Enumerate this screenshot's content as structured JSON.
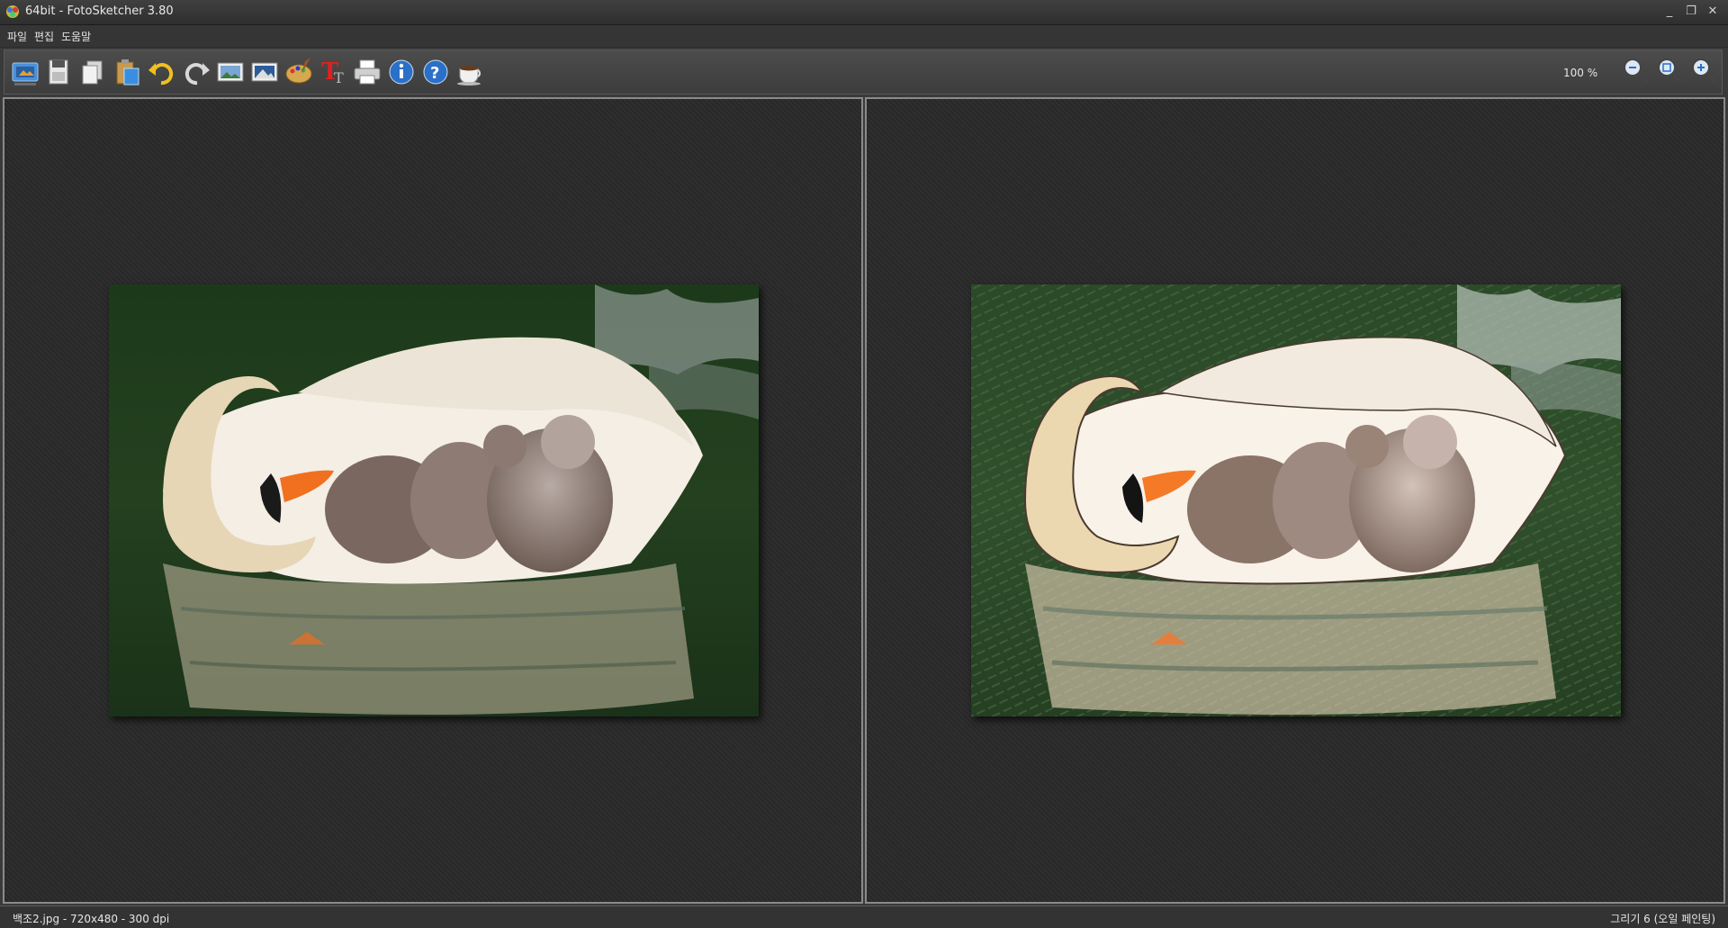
{
  "window": {
    "title": "64bit - FotoSketcher 3.80",
    "minimize": "_",
    "restore": "❐",
    "close": "✕"
  },
  "menu": [
    "파일",
    "편집",
    "도움말"
  ],
  "toolbar": {
    "icons": [
      "open-icon",
      "save-icon",
      "copy-icon",
      "paste-icon",
      "undo-icon",
      "redo-icon",
      "image-icon",
      "landscape-icon",
      "palette-icon",
      "text-icon",
      "print-icon",
      "info-icon",
      "help-icon",
      "coffee-icon"
    ],
    "zoom_label": "100 %",
    "zoom_icons": [
      "zoom-out-icon",
      "zoom-fit-icon",
      "zoom-in-icon"
    ]
  },
  "status": {
    "left": "백조2.jpg - 720x480 - 300 dpi",
    "right": "그리기 6 (오일 페인팅)"
  },
  "colors": {
    "water": "#1f3a1e",
    "swan": "#f2ece2",
    "beak": "#f07020",
    "cygnet": "#8a7a70"
  }
}
